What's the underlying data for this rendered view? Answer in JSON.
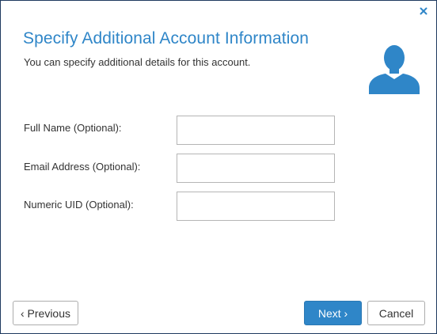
{
  "dialog": {
    "title": "Specify Additional Account Information",
    "subtitle": "You can specify additional details for this account."
  },
  "icons": {
    "close": "close-icon",
    "avatar": "user-avatar-icon"
  },
  "colors": {
    "accent": "#2f86c8",
    "border": "#1f3a5f"
  },
  "form": {
    "fields": [
      {
        "label": "Full Name (Optional):",
        "value": "",
        "placeholder": ""
      },
      {
        "label": "Email Address (Optional):",
        "value": "",
        "placeholder": ""
      },
      {
        "label": "Numeric UID (Optional):",
        "value": "",
        "placeholder": ""
      }
    ]
  },
  "buttons": {
    "previous": "‹ Previous",
    "next": "Next ›",
    "cancel": "Cancel"
  }
}
